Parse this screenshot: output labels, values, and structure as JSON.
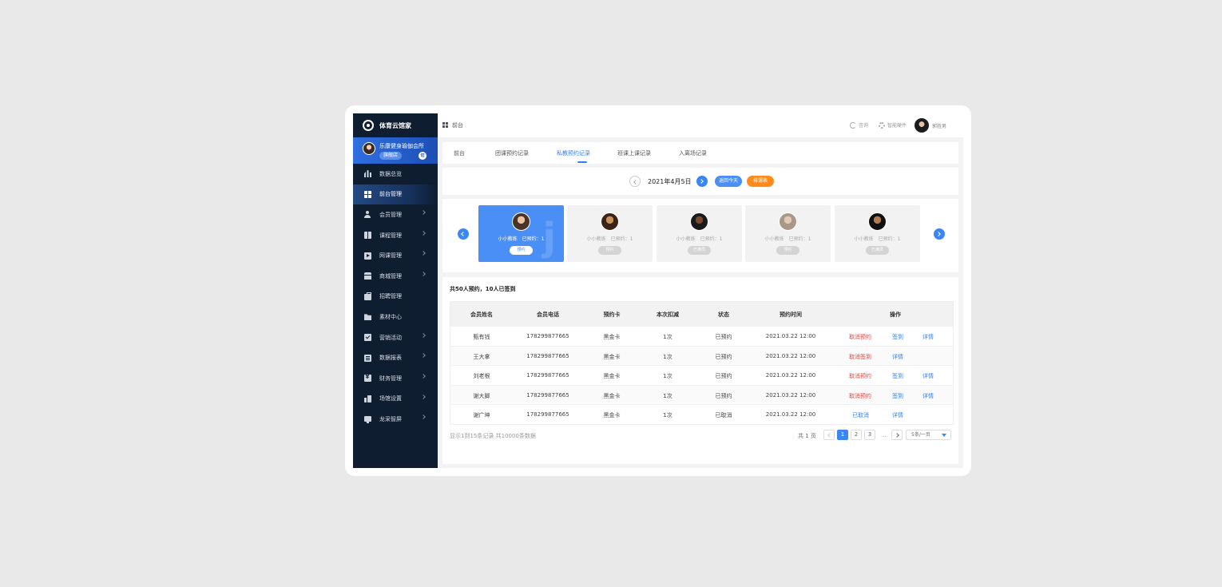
{
  "brand": {
    "name": "体育云馆家"
  },
  "store": {
    "name": "乐康健身瑜伽会所",
    "tag": "旗舰店",
    "switch_label": "切"
  },
  "sidebar": {
    "items": [
      {
        "label": "数据总览",
        "icon": "bar-chart-icon",
        "arrow": false
      },
      {
        "label": "前台管理",
        "icon": "grid-icon",
        "arrow": false,
        "active": true
      },
      {
        "label": "会员管理",
        "icon": "user-icon",
        "arrow": true
      },
      {
        "label": "课程管理",
        "icon": "book-icon",
        "arrow": true
      },
      {
        "label": "网课管理",
        "icon": "play-icon",
        "arrow": true
      },
      {
        "label": "商城管理",
        "icon": "shop-icon",
        "arrow": true
      },
      {
        "label": "招聘管理",
        "icon": "briefcase-icon",
        "arrow": false
      },
      {
        "label": "素材中心",
        "icon": "folder-icon",
        "arrow": false
      },
      {
        "label": "营销活动",
        "icon": "check-icon",
        "arrow": true
      },
      {
        "label": "数据报表",
        "icon": "report-icon",
        "arrow": true
      },
      {
        "label": "财务管理",
        "icon": "money-icon",
        "arrow": true
      },
      {
        "label": "场馆设置",
        "icon": "venue-icon",
        "arrow": true
      },
      {
        "label": "龙采智屏",
        "icon": "screen-icon",
        "arrow": true
      }
    ]
  },
  "header": {
    "breadcrumb": "前台",
    "consult": "咨询",
    "hardware": "智能硬件",
    "user": "郭胜男"
  },
  "tabs": [
    "前台",
    "团课预约记录",
    "私教预约记录",
    "班课上课记录",
    "入离场记录"
  ],
  "active_tab": 2,
  "datebar": {
    "date": "2021年4月5日",
    "today_label": "返回今天",
    "schedule_label": "排课表"
  },
  "coaches": [
    {
      "name": "小小教练",
      "booked": "已预约：1",
      "button": "预约",
      "active": true,
      "skin": "#e9c3a4",
      "hair": "#4a3428"
    },
    {
      "name": "小小教练",
      "booked": "已预约：1",
      "button": "预约",
      "active": false,
      "skin": "#c9905e",
      "hair": "#3b2414"
    },
    {
      "name": "小小教练",
      "booked": "已预约：1",
      "button": "已满员",
      "active": false,
      "skin": "#7a4a2e",
      "hair": "#1a1a1a"
    },
    {
      "name": "小小教练",
      "booked": "已预约：1",
      "button": "预约",
      "active": false,
      "skin": "#e4c8b4",
      "hair": "#a89888"
    },
    {
      "name": "小小教练",
      "booked": "已预约：1",
      "button": "已满员",
      "active": false,
      "skin": "#b07a52",
      "hair": "#111111"
    }
  ],
  "summary": "共50人预约，10人已签到",
  "table": {
    "headers": [
      "会员姓名",
      "会员电话",
      "预约卡",
      "本次扣减",
      "状态",
      "预约时间",
      "操作"
    ],
    "rows": [
      {
        "name": "甄有钱",
        "phone": "178299877665",
        "card": "黑金卡",
        "deduct": "1次",
        "status": "已预约",
        "time": "2021.03.22 12:00",
        "ops": [
          {
            "label": "取消预约",
            "color": "red"
          },
          {
            "label": "签到",
            "color": "blue"
          },
          {
            "label": "详情",
            "color": "blue"
          }
        ]
      },
      {
        "name": "王大拿",
        "phone": "178299877665",
        "card": "黑金卡",
        "deduct": "1次",
        "status": "已预约",
        "time": "2021.03.22 12:00",
        "ops": [
          {
            "label": "取消签到",
            "color": "red"
          },
          {
            "label": "详情",
            "color": "blue"
          }
        ]
      },
      {
        "name": "刘老根",
        "phone": "178299877665",
        "card": "黑金卡",
        "deduct": "1次",
        "status": "已预约",
        "time": "2021.03.22 12:00",
        "ops": [
          {
            "label": "取消预约",
            "color": "red"
          },
          {
            "label": "签到",
            "color": "blue"
          },
          {
            "label": "详情",
            "color": "blue"
          }
        ]
      },
      {
        "name": "谢大脚",
        "phone": "178299877665",
        "card": "黑金卡",
        "deduct": "1次",
        "status": "已预约",
        "time": "2021.03.22 12:00",
        "ops": [
          {
            "label": "取消预约",
            "color": "red"
          },
          {
            "label": "签到",
            "color": "blue"
          },
          {
            "label": "详情",
            "color": "blue"
          }
        ]
      },
      {
        "name": "谢广坤",
        "phone": "178299877665",
        "card": "黑金卡",
        "deduct": "1次",
        "status": "已取消",
        "time": "2021.03.22 12:00",
        "ops": [
          {
            "label": "已取消",
            "color": "blue"
          },
          {
            "label": "详情",
            "color": "blue"
          }
        ]
      }
    ]
  },
  "pagination": {
    "info": "显示1到15条记录 共10000条数据",
    "total_pages": "共 1 页",
    "pages": [
      "1",
      "2",
      "3"
    ],
    "current": "1",
    "ellipsis": "...",
    "page_size": "5条/一页"
  },
  "colors": {
    "accent": "#3a86f5",
    "sidebar_bg": "#0f1d31",
    "danger": "#e8413a",
    "warning": "#ff8b1a"
  }
}
